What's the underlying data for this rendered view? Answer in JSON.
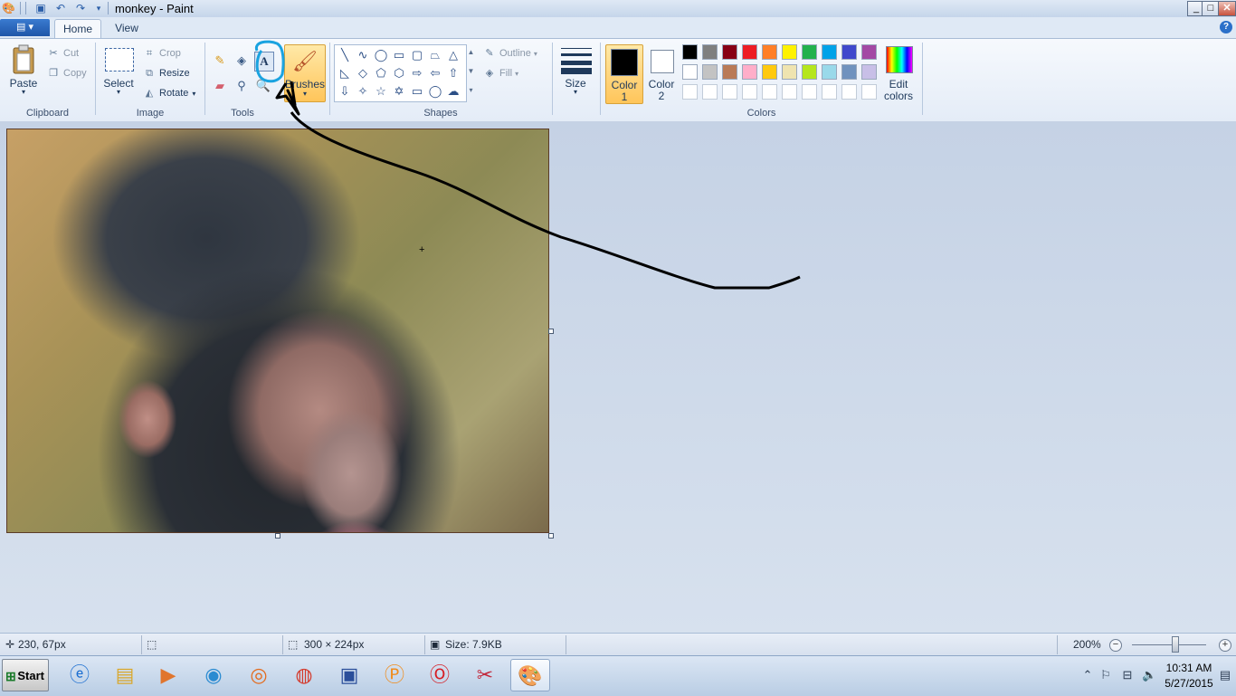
{
  "window": {
    "title": "monkey - Paint"
  },
  "window_buttons": {
    "minimize": "_",
    "maximize": "□",
    "close": "✕"
  },
  "tabs": {
    "file": "▤ ▾",
    "home": "Home",
    "view": "View"
  },
  "help": "?",
  "clipboard": {
    "paste": "Paste",
    "cut": "Cut",
    "copy": "Copy",
    "group": "Clipboard"
  },
  "image": {
    "select": "Select",
    "crop": "Crop",
    "resize": "Resize",
    "rotate": "Rotate",
    "group": "Image"
  },
  "tools": {
    "group": "Tools",
    "text_tool": "A",
    "brushes": "Brushes"
  },
  "shapes": {
    "outline": "Outline",
    "fill": "Fill",
    "group": "Shapes",
    "size": "Size"
  },
  "colors": {
    "color1_label_1": "Color",
    "color1_label_2": "1",
    "color2_label_1": "Color",
    "color2_label_2": "2",
    "edit_label_1": "Edit",
    "edit_label_2": "colors",
    "group": "Colors",
    "color1": "#000000",
    "color2": "#ffffff",
    "row1": [
      "#000000",
      "#7f7f7f",
      "#880015",
      "#ed1c24",
      "#ff7f27",
      "#fff200",
      "#22b14c",
      "#00a2e8",
      "#3f48cc",
      "#a349a4"
    ],
    "row2": [
      "#ffffff",
      "#c3c3c3",
      "#b97a57",
      "#ffaec9",
      "#ffc90e",
      "#efe4b0",
      "#b5e61d",
      "#99d9ea",
      "#7092be",
      "#c8bfe7"
    ],
    "row3": [
      "#ffffff",
      "#ffffff",
      "#ffffff",
      "#ffffff",
      "#ffffff",
      "#ffffff",
      "#ffffff",
      "#ffffff",
      "#ffffff",
      "#ffffff"
    ]
  },
  "status": {
    "cursor_pos": "230, 67px",
    "dimensions": "300 × 224px",
    "size": "Size: 7.9KB",
    "zoom": "200%"
  },
  "taskbar": {
    "start": "Start",
    "time": "10:31 AM",
    "date": "5/27/2015"
  },
  "annotation_color": "#1aa3e0"
}
